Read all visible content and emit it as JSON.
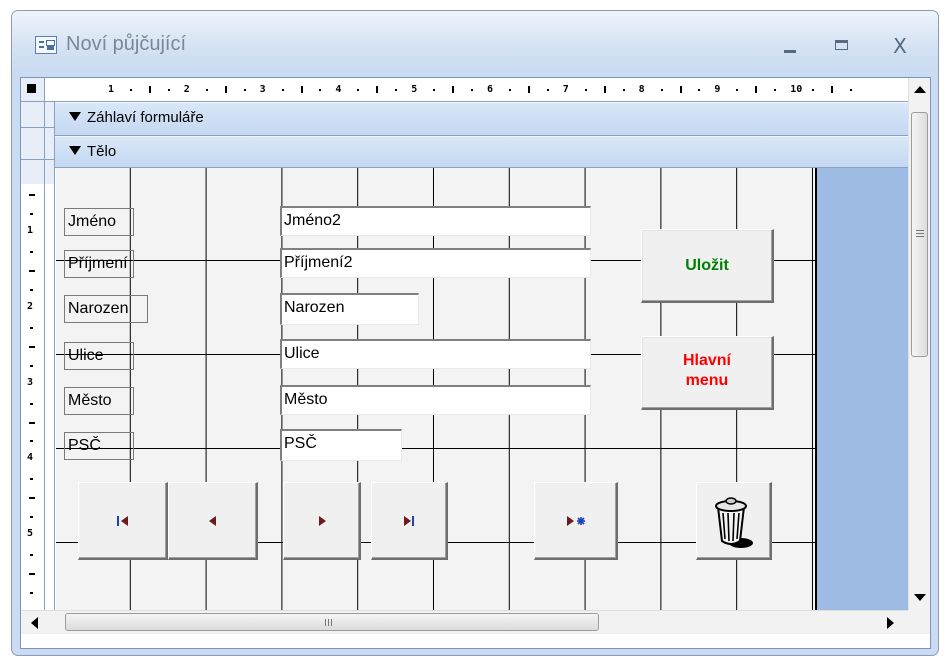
{
  "window": {
    "title": "Noví půjčující",
    "minimize_label": "_",
    "close_label": "X"
  },
  "ruler": {
    "h_numbers": [
      "1",
      "2",
      "3",
      "4",
      "5",
      "6",
      "7",
      "8",
      "9",
      "10"
    ],
    "v_numbers": [
      "1",
      "2",
      "3",
      "4",
      "5"
    ]
  },
  "sections": {
    "form_header": "Záhlaví formuláře",
    "detail": "Tělo"
  },
  "fields": [
    {
      "label": "Jméno",
      "value": "Jméno2"
    },
    {
      "label": "Příjmení",
      "value": "Příjmení2"
    },
    {
      "label": "Narozen",
      "value": "Narozen"
    },
    {
      "label": "Ulice",
      "value": "Ulice"
    },
    {
      "label": "Město",
      "value": "Město"
    },
    {
      "label": "PSČ",
      "value": "PSČ"
    }
  ],
  "buttons": {
    "save": {
      "label": "Uložit",
      "color": "#008000"
    },
    "main_menu": {
      "label_line1": "Hlavní",
      "label_line2": "menu",
      "color": "#ff0000"
    }
  },
  "nav_buttons": [
    {
      "icon": "first-record-icon"
    },
    {
      "icon": "previous-record-icon"
    },
    {
      "icon": "next-record-icon"
    },
    {
      "icon": "last-record-icon"
    },
    {
      "icon": "new-record-icon"
    },
    {
      "icon": "trash-icon"
    }
  ],
  "colors": {
    "nav_icon": "#6a1b1b",
    "new_star": "#1a3fc0",
    "detail_background": "#9dbbe3"
  }
}
